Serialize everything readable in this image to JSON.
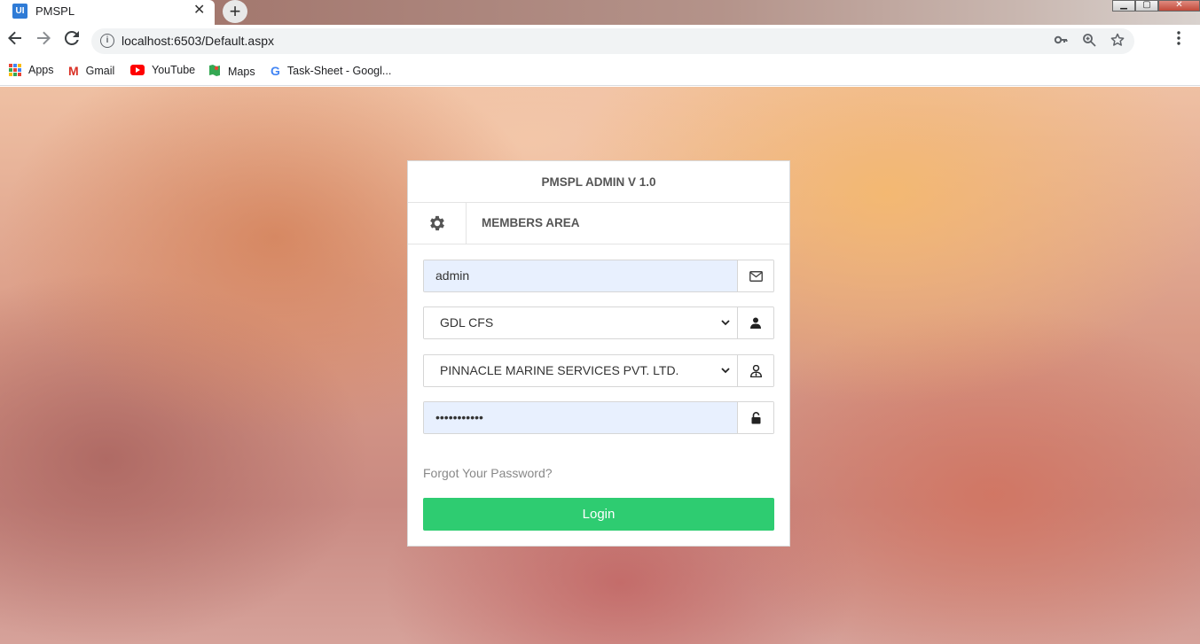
{
  "browser": {
    "tab_title": "PMSPL",
    "tab_favicon": "UI",
    "tab_close": "✕",
    "new_tab": "+",
    "url": "localhost:6503/Default.aspx",
    "bookmarks": [
      {
        "label": "Apps",
        "icon": "apps-grid-icon"
      },
      {
        "label": "Gmail",
        "icon": "gmail-icon"
      },
      {
        "label": "YouTube",
        "icon": "youtube-icon"
      },
      {
        "label": "Maps",
        "icon": "maps-icon"
      },
      {
        "label": "Task-Sheet - Googl...",
        "icon": "google-icon"
      }
    ]
  },
  "login": {
    "app_title": "PMSPL ADMIN V 1.0",
    "section_title": "MEMBERS AREA",
    "username_value": "admin",
    "location_selected": "GDL CFS",
    "company_selected": "PINNACLE MARINE SERVICES PVT. LTD.",
    "password_value": "•••••••••••",
    "forgot_link": "Forgot Your Password?",
    "login_label": "Login"
  },
  "colors": {
    "login_button": "#2ecc71",
    "autofill_bg": "#e8f0fe"
  }
}
